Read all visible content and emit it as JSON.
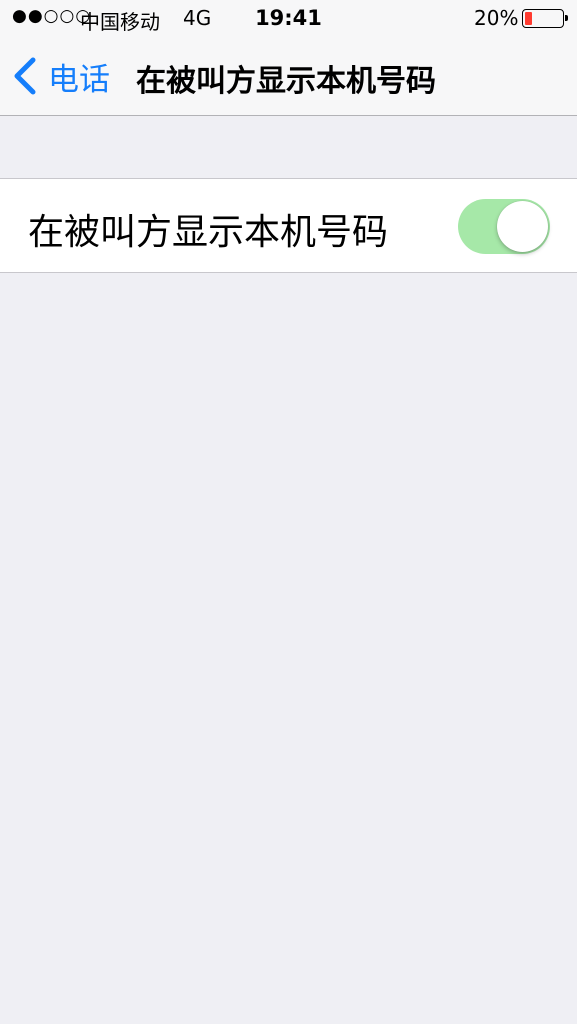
{
  "status_bar": {
    "signal": "●●○○○",
    "carrier": "中国移动",
    "network": "4G",
    "time": "19:41",
    "battery_percent": "20%",
    "battery_level": 0.2,
    "battery_color": "#ff3b30"
  },
  "nav": {
    "back_label": "电话",
    "title": "在被叫方显示本机号码",
    "accent_color": "#157efb"
  },
  "setting": {
    "label": "在被叫方显示本机号码",
    "enabled": true,
    "toggle_on_color": "#a6e8a8"
  }
}
